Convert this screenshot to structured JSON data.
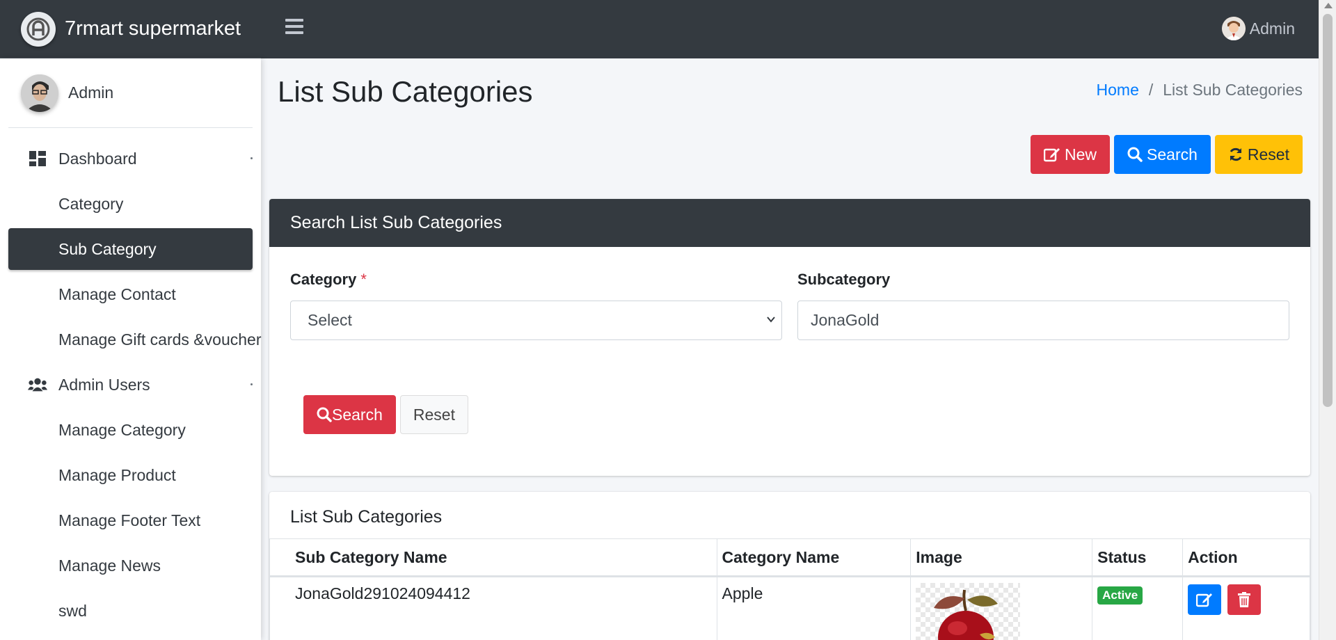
{
  "brand": {
    "title": "7rmart supermarket"
  },
  "topbar": {
    "user_label": "Admin"
  },
  "sidebar": {
    "user_name": "Admin",
    "items": [
      {
        "label": "Dashboard",
        "icon": "dashboard-icon",
        "active": false
      },
      {
        "label": "Category",
        "active": false
      },
      {
        "label": "Sub Category",
        "active": true
      },
      {
        "label": "Manage Contact",
        "active": false
      },
      {
        "label": "Manage Gift cards &voucher",
        "active": false
      },
      {
        "label": "Admin Users",
        "icon": "users-icon",
        "active": false
      },
      {
        "label": "Manage Category",
        "active": false
      },
      {
        "label": "Manage Product",
        "active": false
      },
      {
        "label": "Manage Footer Text",
        "active": false
      },
      {
        "label": "Manage News",
        "active": false
      },
      {
        "label": "swd",
        "active": false
      }
    ]
  },
  "page": {
    "title": "List Sub Categories",
    "breadcrumb": {
      "home": "Home",
      "separator": "/",
      "current": "List Sub Categories"
    },
    "actions": {
      "new": "New",
      "search": "Search",
      "reset": "Reset"
    }
  },
  "search_card": {
    "title": "Search List Sub Categories",
    "category_label": "Category",
    "required_mark": "*",
    "category_value": "Select",
    "subcategory_label": "Subcategory",
    "subcategory_value": "JonaGold",
    "search_button": "Search",
    "reset_button": "Reset"
  },
  "list_card": {
    "title": "List Sub Categories",
    "columns": [
      "Sub Category Name",
      "Category Name",
      "Image",
      "Status",
      "Action"
    ],
    "rows": [
      {
        "sub_category": "JonaGold291024094412",
        "category": "Apple",
        "image": "apple-image",
        "status": "Active"
      }
    ]
  },
  "colors": {
    "navbar": "#343a40",
    "primary": "#007bff",
    "danger": "#dc3545",
    "warning": "#ffc107",
    "success": "#28a745"
  }
}
